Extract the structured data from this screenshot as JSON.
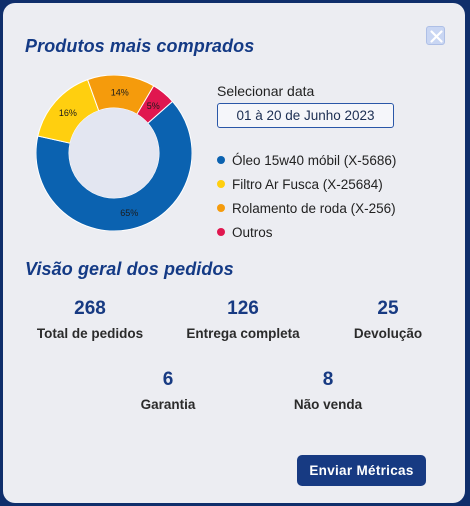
{
  "header": {
    "title": "Produtos mais comprados"
  },
  "date": {
    "label": "Selecionar data",
    "value": "01 à 20 de Junho 2023"
  },
  "chart_data": {
    "type": "pie",
    "donut": true,
    "slices": [
      {
        "name": "Óleo 15w40 móbil (X-5686)",
        "value": 65,
        "label": "65%",
        "color": "#0b62b0"
      },
      {
        "name": "Filtro Ar Fusca  (X-25684)",
        "value": 16,
        "label": "16%",
        "color": "#ffcf0f"
      },
      {
        "name": "Rolamento de roda (X-256)",
        "value": 14,
        "label": "14%",
        "color": "#f59b0c"
      },
      {
        "name": "Outros",
        "value": 5,
        "label": "5%",
        "color": "#e0174f"
      }
    ],
    "legend_placement": "right"
  },
  "overview": {
    "title": "Visão geral dos pedidos",
    "metrics": [
      {
        "value": "268",
        "label": "Total de pedidos"
      },
      {
        "value": "126",
        "label": "Entrega completa"
      },
      {
        "value": "25",
        "label": "Devolução"
      },
      {
        "value": "6",
        "label": "Garantia"
      },
      {
        "value": "8",
        "label": "Não venda"
      }
    ]
  },
  "actions": {
    "send_label": "Enviar Métricas"
  },
  "icons": {
    "close": "close-icon",
    "legend_marker": "dot-icon"
  }
}
